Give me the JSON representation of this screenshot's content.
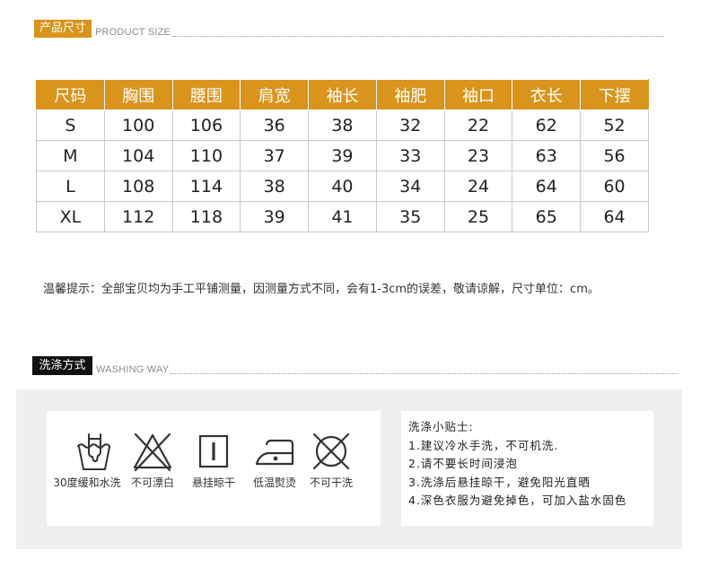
{
  "colors": {
    "accent": "#d8941b",
    "wash_tag": "#111111",
    "panel": "#efefef"
  },
  "size_section": {
    "title": "产品尺寸",
    "subtitle": "PRODUCT SIZE"
  },
  "size_table": {
    "headers": [
      "尺码",
      "胸围",
      "腰围",
      "肩宽",
      "袖长",
      "袖肥",
      "袖口",
      "衣长",
      "下摆"
    ],
    "rows": [
      [
        "S",
        "100",
        "106",
        "36",
        "38",
        "32",
        "22",
        "62",
        "52"
      ],
      [
        "M",
        "104",
        "110",
        "37",
        "39",
        "33",
        "23",
        "63",
        "56"
      ],
      [
        "L",
        "108",
        "114",
        "38",
        "40",
        "34",
        "24",
        "64",
        "60"
      ],
      [
        "XL",
        "112",
        "118",
        "39",
        "41",
        "35",
        "25",
        "65",
        "64"
      ]
    ]
  },
  "note": "温馨提示：全部宝贝均为手工平铺测量，因测量方式不同，会有1-3cm的误差，敬请谅解，尺寸单位：cm。",
  "wash_section": {
    "title": "洗涤方式",
    "subtitle": "WASHING WAY"
  },
  "care_icons": [
    {
      "icon": "hand-wash-30-icon",
      "label": "30度缓和水洗"
    },
    {
      "icon": "no-bleach-icon",
      "label": "不可漂白"
    },
    {
      "icon": "line-dry-icon",
      "label": "悬挂晾干"
    },
    {
      "icon": "iron-low-heat-icon",
      "label": "低温熨烫"
    },
    {
      "icon": "no-dry-clean-icon",
      "label": "不可干洗"
    }
  ],
  "tips": {
    "title": "洗涤小贴士:",
    "items": [
      "1.建议冷水手洗，不可机洗.",
      "2.请不要长时间浸泡",
      "3.洗涤后悬挂晾干，避免阳光直晒",
      "4.深色衣服为避免掉色，可加入盐水固色"
    ]
  }
}
